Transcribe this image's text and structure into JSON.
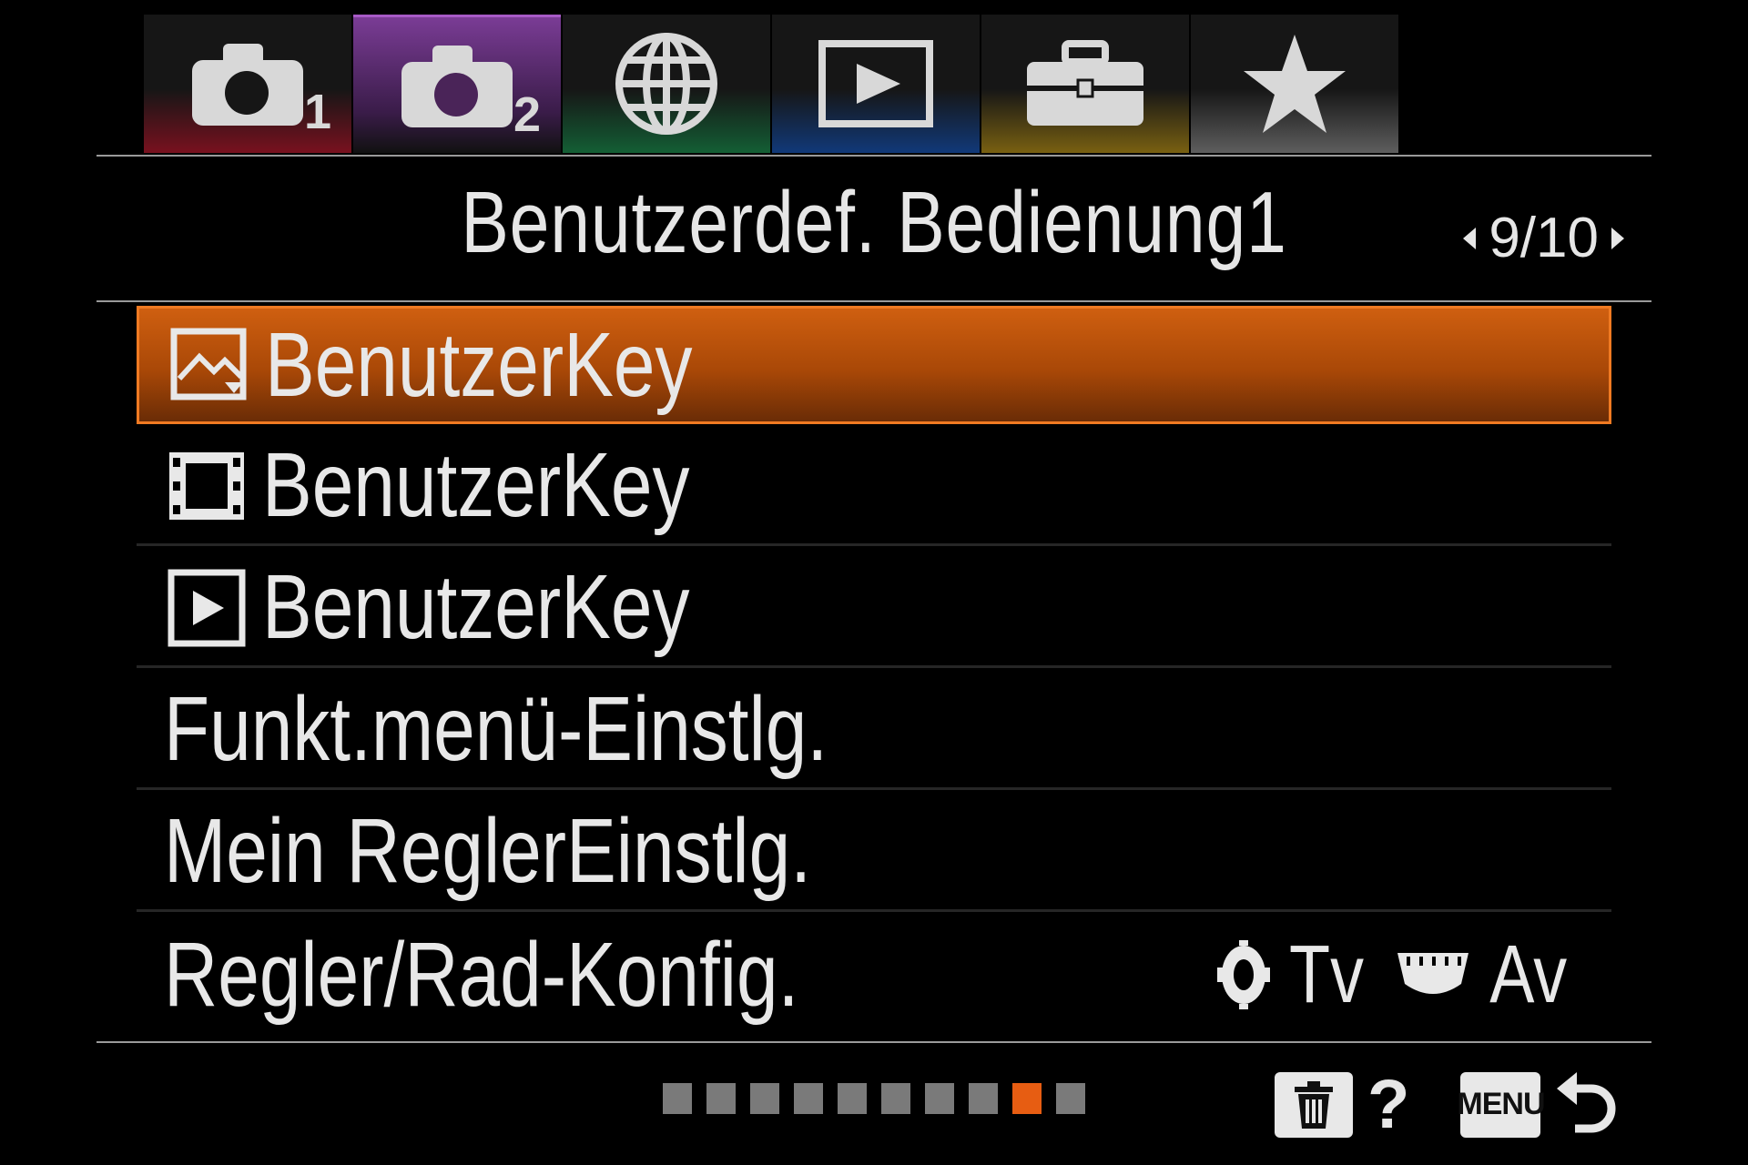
{
  "tabs": [
    {
      "name": "camera-settings-1",
      "icon": "camera-icon",
      "sub": "1",
      "accent": "#8a1020"
    },
    {
      "name": "camera-settings-2",
      "icon": "camera-icon",
      "sub": "2",
      "accent": "#7a3c95",
      "active": true
    },
    {
      "name": "network",
      "icon": "globe-icon",
      "sub": "",
      "accent": "#136b3a"
    },
    {
      "name": "playback",
      "icon": "play-icon",
      "sub": "",
      "accent": "#103f8a"
    },
    {
      "name": "setup",
      "icon": "toolbox-icon",
      "sub": "",
      "accent": "#8a6d10"
    },
    {
      "name": "my-menu",
      "icon": "star-icon",
      "sub": "",
      "accent": "#6a6a6a"
    }
  ],
  "header": {
    "title": "Benutzerdef. Bedienung1",
    "page": "9/10"
  },
  "menu": {
    "items": [
      {
        "label": "BenutzerKey",
        "icon": "still-image-icon",
        "selected": true
      },
      {
        "label": "BenutzerKey",
        "icon": "movie-icon"
      },
      {
        "label": "BenutzerKey",
        "icon": "playback-icon"
      },
      {
        "label": "Funkt.menü-Einstlg."
      },
      {
        "label": "Mein ReglerEinstlg."
      },
      {
        "label": "Regler/Rad-Konfig.",
        "value_front": "Tv",
        "value_rear": "Av",
        "value_front_icon": "front-dial-icon",
        "value_rear_icon": "rear-dial-icon"
      }
    ]
  },
  "footer": {
    "page_dots": 10,
    "current_page": 9,
    "help": "?",
    "menu_label": "MENU",
    "accent": "#e75d12"
  }
}
